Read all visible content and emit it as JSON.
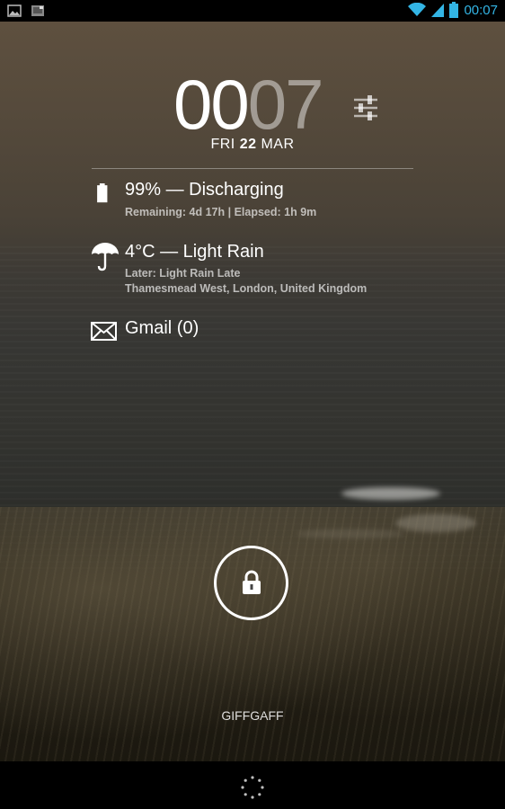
{
  "status_bar": {
    "left_icons": [
      "gallery-icon",
      "photo-notification-icon"
    ],
    "right_icons": [
      "wifi-icon",
      "signal-icon",
      "battery-icon"
    ],
    "time": "00:07",
    "accent_color": "#33b5e5"
  },
  "clock": {
    "hours": "00",
    "minutes": "07",
    "date_day": "FRI",
    "date_num": "22",
    "date_month": "MAR"
  },
  "battery": {
    "title": "99% — Discharging",
    "detail": "Remaining: 4d 17h | Elapsed: 1h 9m",
    "level": 0.99
  },
  "weather": {
    "title": "4°C — Light Rain",
    "later": "Later: Light Rain Late",
    "location": "Thamesmead West, London, United Kingdom"
  },
  "gmail": {
    "title": "Gmail (0)"
  },
  "lock": {
    "icon": "padlock-icon"
  },
  "carrier": "GIFFGAFF"
}
